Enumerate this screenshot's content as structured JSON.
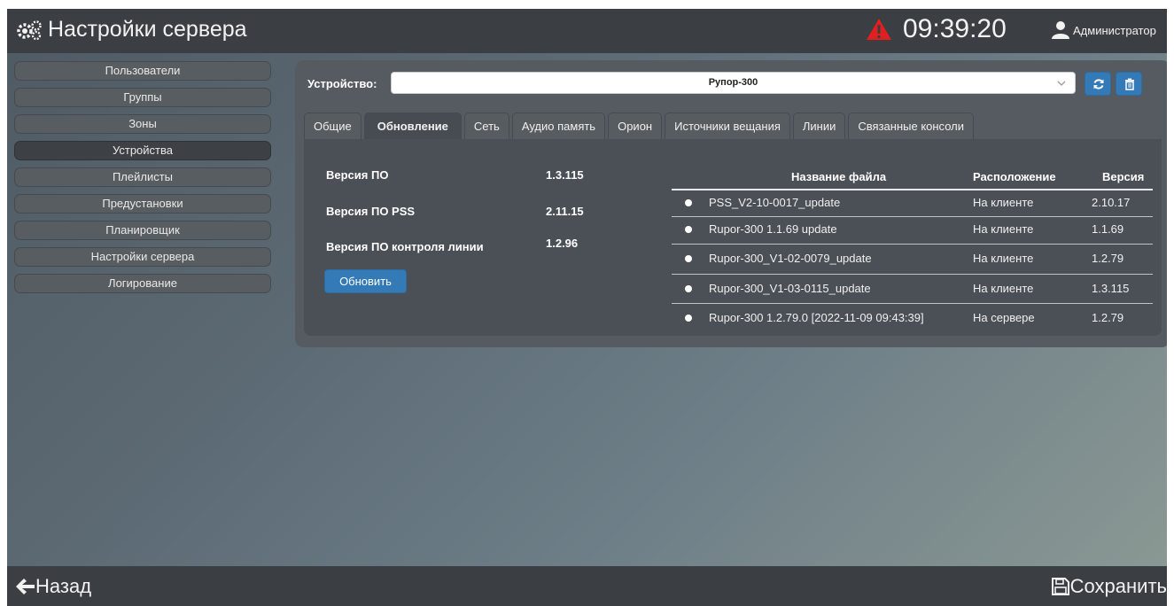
{
  "header": {
    "title": "Настройки сервера",
    "time": "09:39:20",
    "user": "Администратор"
  },
  "sidebar": {
    "items": [
      {
        "label": "Пользователи"
      },
      {
        "label": "Группы"
      },
      {
        "label": "Зоны"
      },
      {
        "label": "Устройства",
        "active": true
      },
      {
        "label": "Плейлисты"
      },
      {
        "label": "Предустановки"
      },
      {
        "label": "Планировщик"
      },
      {
        "label": "Настройки сервера"
      },
      {
        "label": "Логирование"
      }
    ]
  },
  "device": {
    "label": "Устройство:",
    "selected": "Рупор-300"
  },
  "tabs": [
    {
      "label": "Общие"
    },
    {
      "label": "Обновление",
      "active": true
    },
    {
      "label": "Сеть"
    },
    {
      "label": "Аудио память"
    },
    {
      "label": "Орион"
    },
    {
      "label": "Источники вещания"
    },
    {
      "label": "Линии"
    },
    {
      "label": "Связанные консоли"
    }
  ],
  "versions": [
    {
      "label": "Версия ПО",
      "value": "1.3.115"
    },
    {
      "label": "Версия ПО PSS",
      "value": "2.11.15"
    },
    {
      "label": "Версия ПО контроля линии",
      "value": "1.2.96"
    }
  ],
  "update_button": "Обновить",
  "files": {
    "headers": {
      "name": "Название файла",
      "location": "Расположение",
      "version": "Версия"
    },
    "rows": [
      {
        "name": "PSS_V2-10-0017_update",
        "location": "На клиенте",
        "version": "2.10.17"
      },
      {
        "name": "Rupor-300 1.1.69 update",
        "location": "На клиенте",
        "version": "1.1.69"
      },
      {
        "name": "Rupor-300_V1-02-0079_update",
        "location": "На клиенте",
        "version": "1.2.79"
      },
      {
        "name": "Rupor-300_V1-03-0115_update",
        "location": "На клиенте",
        "version": "1.3.115"
      },
      {
        "name": "Rupor-300 1.2.79.0 [2022-11-09 09:43:39]",
        "location": "На сервере",
        "version": "1.2.79"
      }
    ]
  },
  "footer": {
    "back": "Назад",
    "save": "Сохранить"
  },
  "colors": {
    "accent": "#337ab7",
    "alert": "#e02020",
    "bar": "#3b3e42"
  },
  "icons": [
    "gears-icon",
    "warning-icon",
    "user-icon",
    "refresh-icon",
    "trash-icon",
    "arrow-left-icon",
    "floppy-icon",
    "chevron-down-icon"
  ]
}
